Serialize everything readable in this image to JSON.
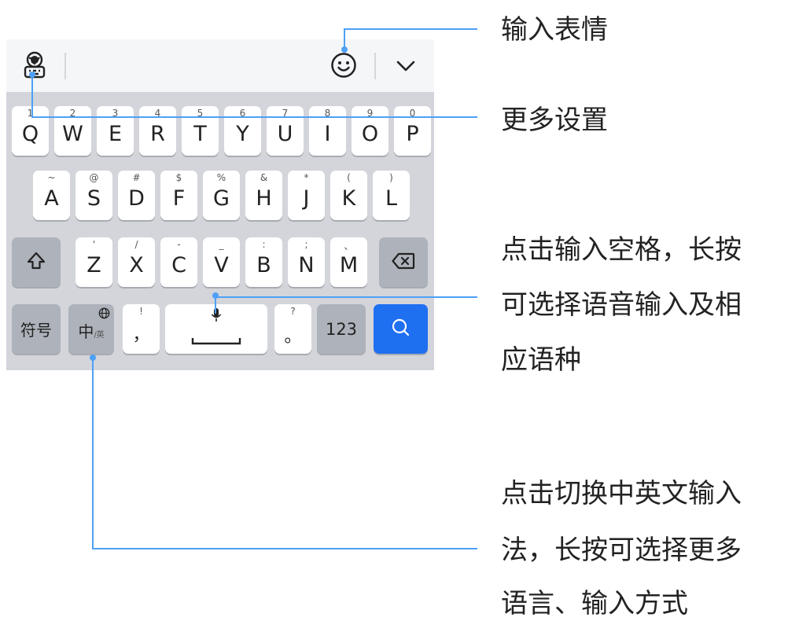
{
  "keyboard": {
    "row1": [
      {
        "main": "Q",
        "hint": "1"
      },
      {
        "main": "W",
        "hint": "2"
      },
      {
        "main": "E",
        "hint": "3"
      },
      {
        "main": "R",
        "hint": "4"
      },
      {
        "main": "T",
        "hint": "5"
      },
      {
        "main": "Y",
        "hint": "6"
      },
      {
        "main": "U",
        "hint": "7"
      },
      {
        "main": "I",
        "hint": "8"
      },
      {
        "main": "O",
        "hint": "9"
      },
      {
        "main": "P",
        "hint": "0"
      }
    ],
    "row2": [
      {
        "main": "A",
        "hint": "~"
      },
      {
        "main": "S",
        "hint": "@"
      },
      {
        "main": "D",
        "hint": "#"
      },
      {
        "main": "F",
        "hint": "$"
      },
      {
        "main": "G",
        "hint": "%"
      },
      {
        "main": "H",
        "hint": "&"
      },
      {
        "main": "J",
        "hint": "*"
      },
      {
        "main": "K",
        "hint": "("
      },
      {
        "main": "L",
        "hint": ")"
      }
    ],
    "row3": [
      {
        "main": "Z",
        "hint": "'"
      },
      {
        "main": "X",
        "hint": "/"
      },
      {
        "main": "C",
        "hint": "-"
      },
      {
        "main": "V",
        "hint": "_"
      },
      {
        "main": "B",
        "hint": ":"
      },
      {
        "main": "N",
        "hint": ";"
      },
      {
        "main": "M",
        "hint": "、"
      }
    ],
    "bottom": {
      "symbols": "符号",
      "lang_main": "中",
      "lang_sub": "/英",
      "comma": "，",
      "comma_hint": "!",
      "period": "。",
      "period_hint": "?",
      "numbers": "123"
    },
    "icons": {
      "settings": "settings-icon",
      "emoji": "emoji-icon",
      "collapse": "chevron-down-icon",
      "shift": "shift-icon",
      "backspace": "backspace-icon",
      "mic": "mic-icon",
      "globe": "globe-icon",
      "search": "search-icon"
    },
    "colors": {
      "accent": "#1f6ff1",
      "callout": "#4ea0f5"
    }
  },
  "callouts": {
    "emoji": [
      "输入表情"
    ],
    "settings": [
      "更多设置"
    ],
    "space": [
      "点击输入空格，长按",
      "可选择语音输入及相",
      "应语种"
    ],
    "lang": [
      "点击切换中英文输入",
      "法，长按可选择更多",
      "语言、输入方式"
    ]
  }
}
